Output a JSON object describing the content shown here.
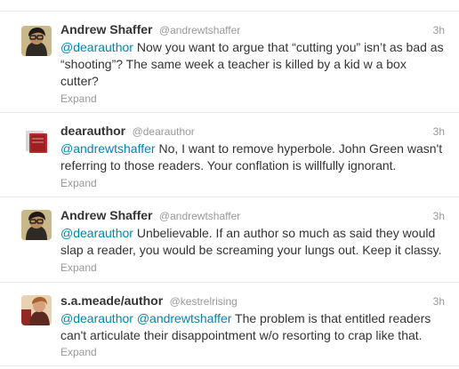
{
  "tweets": [
    {
      "fullname": "Andrew Shaffer",
      "username": "@andrewtshaffer",
      "time": "3h",
      "mentions": [
        "@dearauthor"
      ],
      "text": " Now you want to argue that “cutting you” isn’t as bad as “shooting”? The same week a teacher is killed by a kid w a box cutter?",
      "expand": "Expand",
      "avatar_icon": "andrew-shaffer-avatar"
    },
    {
      "fullname": "dearauthor",
      "username": "@dearauthor",
      "time": "3h",
      "mentions": [
        "@andrewtshaffer"
      ],
      "text": " No, I want to remove hyperbole. John Green wasn't referring to those readers. Your conflation is willfully ignorant.",
      "expand": "Expand",
      "avatar_icon": "dearauthor-avatar"
    },
    {
      "fullname": "Andrew Shaffer",
      "username": "@andrewtshaffer",
      "time": "3h",
      "mentions": [
        "@dearauthor"
      ],
      "text": " Unbelievable. If an author so much as said they would slap a reader, you would be screaming your lungs out. Keep it classy.",
      "expand": "Expand",
      "avatar_icon": "andrew-shaffer-avatar"
    },
    {
      "fullname": "s.a.meade/author",
      "username": "@kestrelrising",
      "time": "3h",
      "mentions": [
        "@dearauthor",
        "@andrewtshaffer"
      ],
      "text": " The problem is that entitled readers can't articulate their disappointment w/o resorting to crap like that.",
      "expand": "Expand",
      "avatar_icon": "kestrelrising-avatar"
    }
  ],
  "colors": {
    "link": "#0084b4",
    "text": "#333333",
    "meta": "#999999",
    "divider": "#e8e8e8"
  }
}
